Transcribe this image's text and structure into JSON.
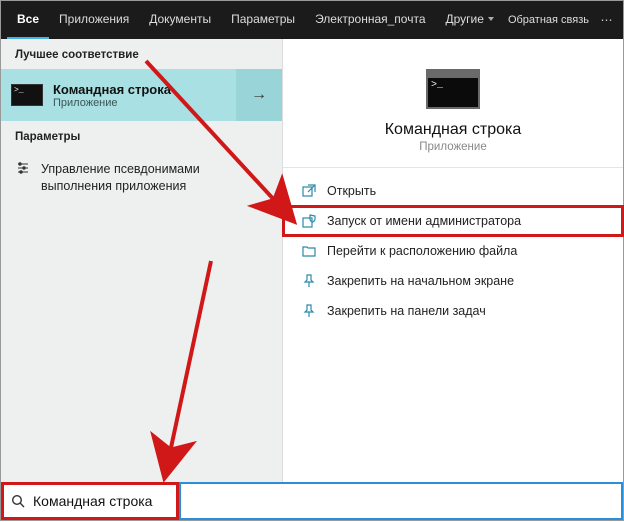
{
  "colors": {
    "accent": "#3fb6e8",
    "highlight": "#a9e0e3",
    "annotation": "#d11818"
  },
  "tabs": {
    "all": "Все",
    "apps": "Приложения",
    "docs": "Документы",
    "settings": "Параметры",
    "email": "Электронная_почта",
    "more": "Другие",
    "feedback": "Обратная связь"
  },
  "left": {
    "best_match_header": "Лучшее соответствие",
    "best_match": {
      "title": "Командная строка",
      "subtitle": "Приложение"
    },
    "params_header": "Параметры",
    "alias_setting": "Управление псевдонимами выполнения приложения"
  },
  "details": {
    "title": "Командная строка",
    "subtitle": "Приложение",
    "actions": {
      "open": "Открыть",
      "run_admin": "Запуск от имени администратора",
      "open_location": "Перейти к расположению файла",
      "pin_start": "Закрепить на начальном экране",
      "pin_taskbar": "Закрепить на панели задач"
    }
  },
  "search": {
    "query": "Командная строка",
    "placeholder": ""
  }
}
